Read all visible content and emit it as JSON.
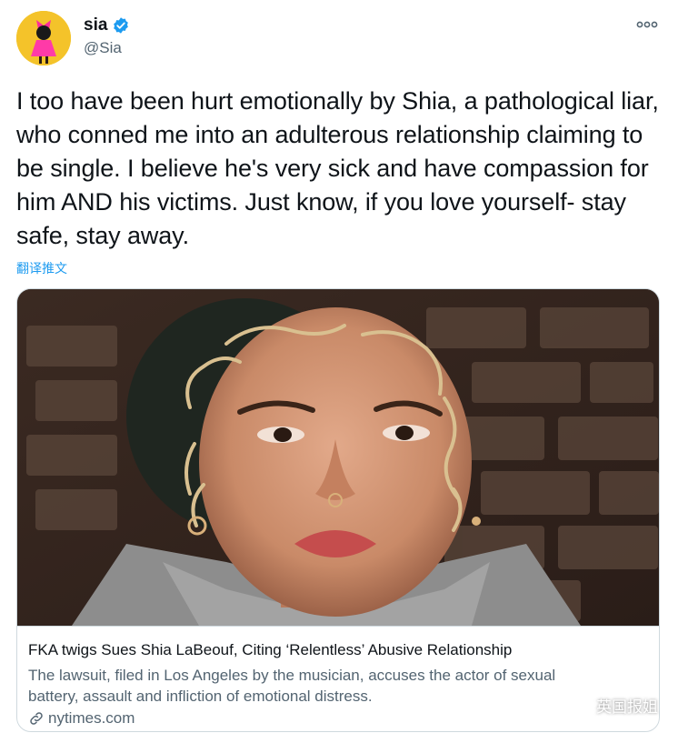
{
  "user": {
    "display_name": "sia",
    "handle": "@Sia",
    "verified": true,
    "avatar_icon": "avatar-bow-figure-icon"
  },
  "tweet": {
    "text": "I too have been hurt emotionally by Shia, a pathological liar, who conned me into an adulterous relationship claiming to be single. I believe he's very sick and have compassion for him AND his victims. Just know, if you love yourself- stay safe, stay away.",
    "translate_label": "翻译推文"
  },
  "card": {
    "title": "FKA twigs Sues Shia LaBeouf, Citing ‘Relentless’ Abusive Relationship",
    "description": "The lawsuit, filed in Los Angeles by the musician, accuses the actor of sexual battery, assault and infliction of emotional distress.",
    "domain": "nytimes.com"
  },
  "watermark": {
    "text": "英国报姐"
  },
  "colors": {
    "accent": "#1d9bf0",
    "text_primary": "#0f1419",
    "text_secondary": "#536471",
    "border": "#cfd9de"
  }
}
